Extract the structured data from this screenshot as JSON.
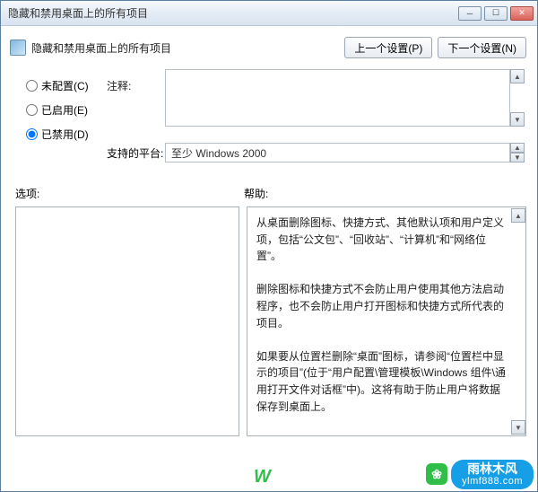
{
  "titlebar": {
    "text": "隐藏和禁用桌面上的所有项目"
  },
  "header": {
    "setting_title": "隐藏和禁用桌面上的所有项目",
    "prev_label": "上一个设置(P)",
    "next_label": "下一个设置(N)"
  },
  "radios": {
    "not_configured": "未配置(C)",
    "enabled": "已启用(E)",
    "disabled": "已禁用(D)"
  },
  "labels": {
    "comment": "注释:",
    "platform": "支持的平台:",
    "options": "选项:",
    "help": "帮助:"
  },
  "platform_value": "至少 Windows 2000",
  "help_text": {
    "p1": "从桌面删除图标、快捷方式、其他默认项和用户定义项，包括“公文包”、“回收站”、“计算机”和“网络位置”。",
    "p2": "删除图标和快捷方式不会防止用户使用其他方法启动程序，也不会防止用户打开图标和快捷方式所代表的项目。",
    "p3": "如果要从位置栏删除“桌面”图标，请参阅“位置栏中显示的项目”(位于“用户配置\\管理模板\\Windows 组件\\通用打开文件对话框”中)。这将有助于防止用户将数据保存到桌面上。"
  },
  "watermark": {
    "brand_cn": "雨林木风",
    "brand_url": "ylmf888.com"
  }
}
